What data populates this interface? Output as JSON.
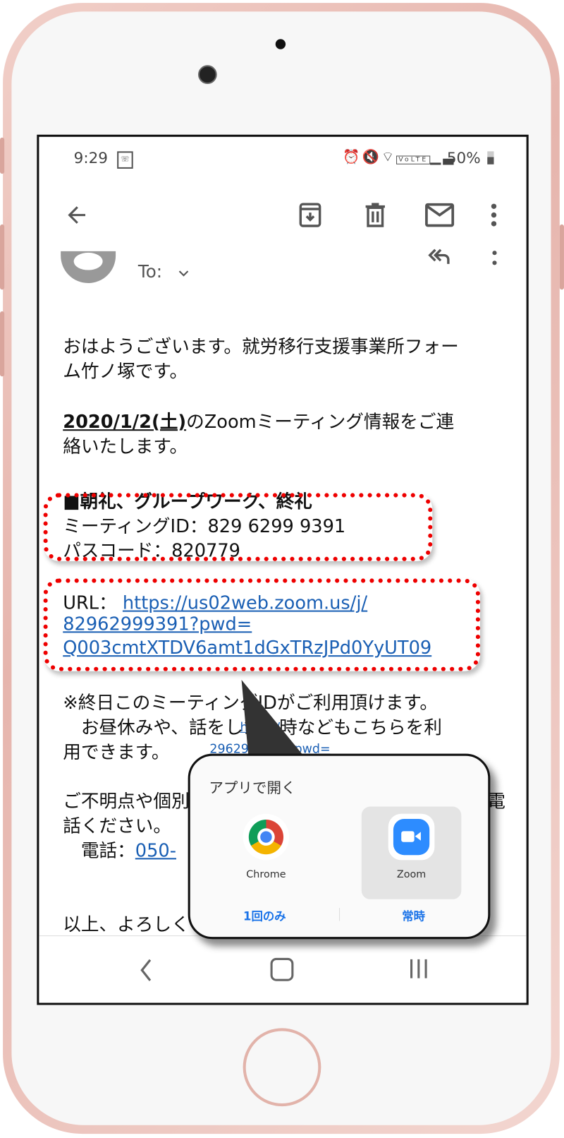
{
  "status_bar": {
    "time": "9:29",
    "battery": "50%",
    "icons": [
      "wifi-call-icon",
      "alarm-icon",
      "mute-icon",
      "wifi-icon",
      "volte-icon",
      "signal-icon",
      "battery-icon"
    ]
  },
  "toolbar": {
    "icons": [
      "back-arrow-icon",
      "archive-icon",
      "trash-icon",
      "mail-icon",
      "more-vert-icon"
    ]
  },
  "header": {
    "to_label": "To:",
    "icons": [
      "avatar",
      "chevron-down-icon",
      "reply-all-icon",
      "more-vert-icon"
    ]
  },
  "email": {
    "lines": [
      "おはようございます。就労移行支援事業所フォー",
      "ム竹ノ塚です。",
      "のZoomミーティング情報をご連",
      "絡いたします。",
      "■朝礼、グループワーク、終礼",
      "ミーティングID：829 6299 9391",
      "パスコード：820779",
      "※終日このミーティングIDがご利用頂けます。",
      "　お昼休みや、話をしたい時などもこちらを利",
      "用できます。",
      "ご不明点や個別",
      "電",
      "話ください。",
      "　電話：",
      "以上、よろしく"
    ],
    "date": "2020/1/2(土)",
    "url_label": "URL：",
    "url_lines": [
      "https://us02web.zoom.us/j/",
      "82962999391?pwd=",
      "Q003cmtXTDV6amt1dGxTRzJPd0YyUT09"
    ],
    "phone_link": "050-",
    "peek_link": [
      "https:/",
      "2962999391?pwd="
    ]
  },
  "popup": {
    "title": "アプリで開く",
    "apps": [
      {
        "name": "Chrome",
        "selected": false
      },
      {
        "name": "Zoom",
        "selected": true
      }
    ],
    "once_button": "1回のみ",
    "always_button": "常時",
    "accent": "#1a73e8"
  },
  "annotation_color": "#e00000"
}
